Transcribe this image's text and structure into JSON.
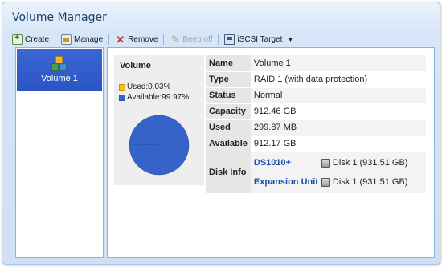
{
  "window": {
    "title": "Volume Manager"
  },
  "toolbar": {
    "create": "Create",
    "manage": "Manage",
    "remove": "Remove",
    "beep_off": "Beep off",
    "iscsi_target": "iSCSI Target"
  },
  "sidebar": {
    "items": [
      {
        "label": "Volume 1"
      }
    ]
  },
  "volume_card": {
    "title": "Volume",
    "legend": [
      {
        "label": "Used:0.03%",
        "color": "#f4c20d"
      },
      {
        "label": "Available:99.97%",
        "color": "#3563c9"
      }
    ]
  },
  "chart_data": {
    "type": "pie",
    "labels": [
      "Used",
      "Available"
    ],
    "values": [
      0.03,
      99.97
    ],
    "colors": [
      "#f4c20d",
      "#3563c9"
    ]
  },
  "details": {
    "name_key": "Name",
    "name_val": "Volume 1",
    "type_key": "Type",
    "type_val": "RAID 1 (with data protection)",
    "status_key": "Status",
    "status_val": "Normal",
    "capacity_key": "Capacity",
    "capacity_val": "912.46 GB",
    "used_key": "Used",
    "used_val": "299.87 MB",
    "available_key": "Available",
    "available_val": "912.17 GB",
    "diskinfo_key": "Disk Info",
    "disks": [
      {
        "device": "DS1010+",
        "disk": "Disk 1 (931.51 GB)"
      },
      {
        "device": "Expansion Unit",
        "disk": "Disk 1 (931.51 GB)"
      }
    ]
  }
}
